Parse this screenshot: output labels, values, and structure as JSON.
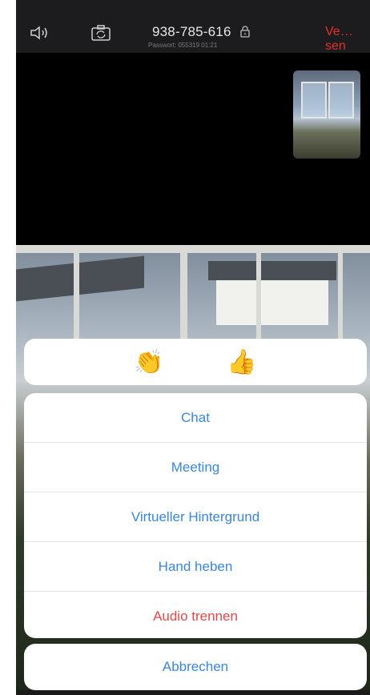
{
  "topbar": {
    "meeting_id": "938-785-616",
    "password_line": "Passwort: 055319  01:21",
    "leave_label": "Ve…sen"
  },
  "reactions": [
    {
      "label": "👏",
      "icon": "clapping-hands-icon"
    },
    {
      "label": "👍",
      "icon": "thumbs-up-icon"
    }
  ],
  "menu": {
    "items": [
      {
        "label": "Chat"
      },
      {
        "label": "Meeting"
      },
      {
        "label": "Virtueller Hintergrund"
      },
      {
        "label": "Hand heben"
      },
      {
        "label": "Audio trennen",
        "style": "danger"
      }
    ],
    "cancel_label": "Abbrechen"
  },
  "colors": {
    "accent": "#3a86d9",
    "danger": "#e0484a",
    "leave": "#e0322f"
  }
}
